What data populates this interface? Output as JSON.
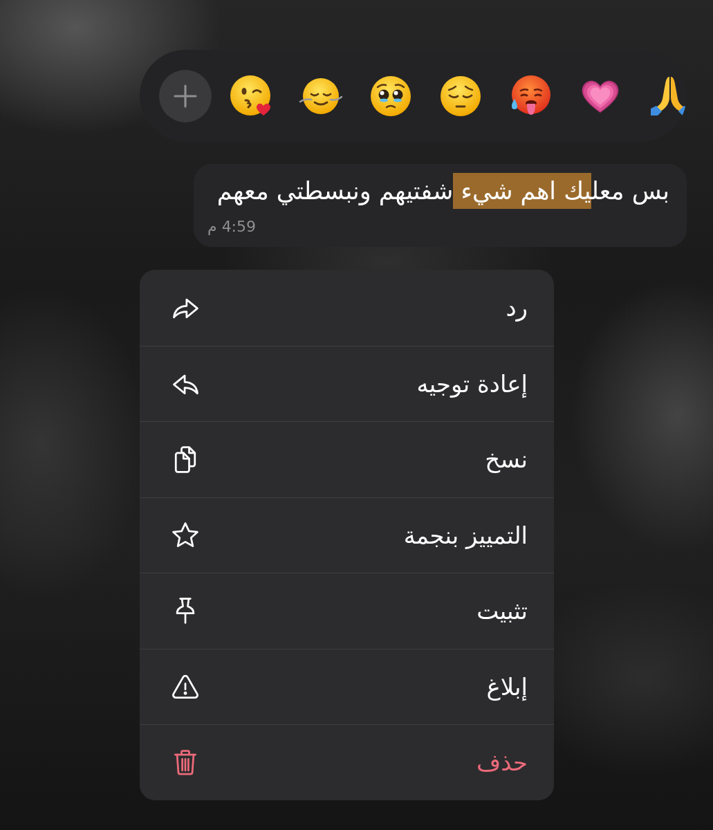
{
  "reaction_bar": {
    "reactions": [
      {
        "kind": "kiss"
      },
      {
        "kind": "swirl"
      },
      {
        "kind": "pleading"
      },
      {
        "kind": "pensive"
      },
      {
        "kind": "hot"
      },
      {
        "kind": "heart"
      },
      {
        "kind": "pray"
      }
    ]
  },
  "message": {
    "segments": [
      {
        "text": "بس معل",
        "highlighted": false
      },
      {
        "text": "يك اهم شيء ",
        "highlighted": true
      },
      {
        "text": "شفتيهم ونبسطتي معهم",
        "highlighted": false
      }
    ],
    "time": "4:59 م"
  },
  "menu": {
    "items": [
      {
        "label": "رد",
        "kind": "reply",
        "destructive": false
      },
      {
        "label": "إعادة توجيه",
        "kind": "forward",
        "destructive": false
      },
      {
        "label": "نسخ",
        "kind": "copy",
        "destructive": false
      },
      {
        "label": "التمييز بنجمة",
        "kind": "star",
        "destructive": false
      },
      {
        "label": "تثبيت",
        "kind": "pin",
        "destructive": false
      },
      {
        "label": "إبلاغ",
        "kind": "report",
        "destructive": false
      },
      {
        "label": "حذف",
        "kind": "delete",
        "destructive": true
      }
    ]
  }
}
